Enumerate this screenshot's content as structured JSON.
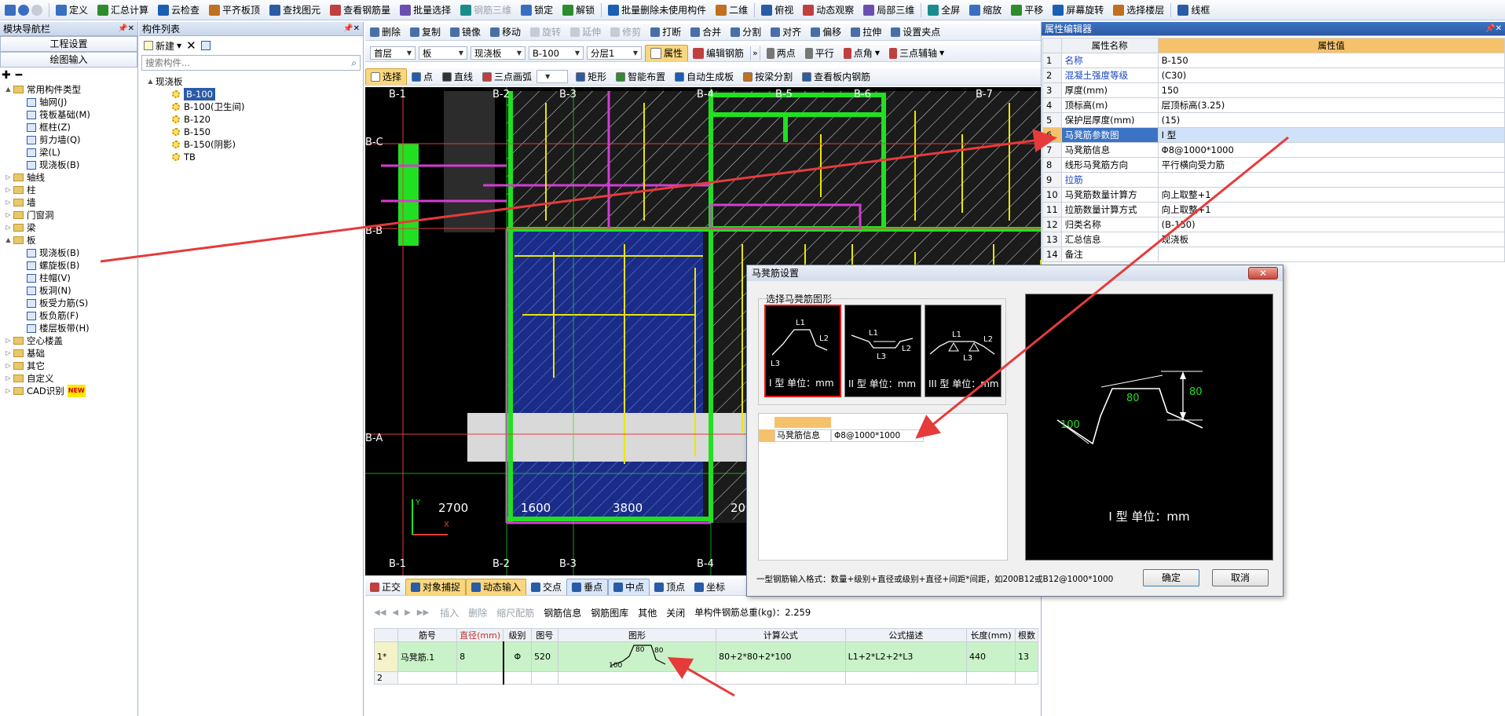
{
  "toolbar": {
    "items": [
      {
        "label": "定义",
        "icon": "define-icon"
      },
      {
        "label": "汇总计算",
        "icon": "sigma-icon"
      },
      {
        "label": "云检查",
        "icon": "cloud-check-icon"
      },
      {
        "label": "平齐板顶",
        "icon": "align-slab-icon"
      },
      {
        "label": "查找图元",
        "icon": "find-icon"
      },
      {
        "label": "查看钢筋量",
        "icon": "rebar-view-icon"
      },
      {
        "label": "批量选择",
        "icon": "batch-select-icon"
      },
      {
        "label": "钢筋三维",
        "icon": "rebar-3d-icon"
      },
      {
        "label": "锁定",
        "icon": "lock-icon"
      },
      {
        "label": "解锁",
        "icon": "unlock-icon"
      },
      {
        "label": "批量删除未使用构件",
        "icon": "batch-delete-icon"
      },
      {
        "label": "二维",
        "icon": "2d-icon"
      },
      {
        "label": "俯视",
        "icon": "top-view-icon"
      },
      {
        "label": "动态观察",
        "icon": "orbit-icon"
      },
      {
        "label": "局部三维",
        "icon": "local-3d-icon"
      },
      {
        "label": "全屏",
        "icon": "fullscreen-icon"
      },
      {
        "label": "缩放",
        "icon": "zoom-icon"
      },
      {
        "label": "平移",
        "icon": "pan-icon"
      },
      {
        "label": "屏幕旋转",
        "icon": "rotate-screen-icon"
      },
      {
        "label": "选择楼层",
        "icon": "floor-select-icon"
      },
      {
        "label": "线框",
        "icon": "wireframe-icon"
      }
    ]
  },
  "nav": {
    "title": "模块导航栏",
    "btn_project": "工程设置",
    "btn_draw": "绘图输入",
    "tree": [
      {
        "label": "常用构件类型",
        "level": 0,
        "type": "folder",
        "exp": "▲"
      },
      {
        "label": "轴网(J)",
        "level": 1,
        "type": "comp"
      },
      {
        "label": "筏板基础(M)",
        "level": 1,
        "type": "comp"
      },
      {
        "label": "框柱(Z)",
        "level": 1,
        "type": "comp"
      },
      {
        "label": "剪力墙(Q)",
        "level": 1,
        "type": "comp"
      },
      {
        "label": "梁(L)",
        "level": 1,
        "type": "comp"
      },
      {
        "label": "现浇板(B)",
        "level": 1,
        "type": "comp"
      },
      {
        "label": "轴线",
        "level": 0,
        "type": "folder",
        "exp": "▷"
      },
      {
        "label": "柱",
        "level": 0,
        "type": "folder",
        "exp": "▷"
      },
      {
        "label": "墙",
        "level": 0,
        "type": "folder",
        "exp": "▷"
      },
      {
        "label": "门窗洞",
        "level": 0,
        "type": "folder",
        "exp": "▷"
      },
      {
        "label": "梁",
        "level": 0,
        "type": "folder",
        "exp": "▷"
      },
      {
        "label": "板",
        "level": 0,
        "type": "folder",
        "exp": "▲"
      },
      {
        "label": "现浇板(B)",
        "level": 1,
        "type": "comp"
      },
      {
        "label": "螺旋板(B)",
        "level": 1,
        "type": "comp"
      },
      {
        "label": "柱帽(V)",
        "level": 1,
        "type": "comp"
      },
      {
        "label": "板洞(N)",
        "level": 1,
        "type": "comp"
      },
      {
        "label": "板受力筋(S)",
        "level": 1,
        "type": "comp"
      },
      {
        "label": "板负筋(F)",
        "level": 1,
        "type": "comp"
      },
      {
        "label": "楼层板带(H)",
        "level": 1,
        "type": "comp"
      },
      {
        "label": "空心楼盖",
        "level": 0,
        "type": "folder",
        "exp": "▷"
      },
      {
        "label": "基础",
        "level": 0,
        "type": "folder",
        "exp": "▷"
      },
      {
        "label": "其它",
        "level": 0,
        "type": "folder",
        "exp": "▷"
      },
      {
        "label": "自定义",
        "level": 0,
        "type": "folder",
        "exp": "▷"
      },
      {
        "label": "CAD识别",
        "level": 0,
        "type": "folder",
        "exp": "▷",
        "badge": "NEW"
      }
    ]
  },
  "comp_list": {
    "title": "构件列表",
    "new_label": "新建",
    "search_placeholder": "搜索构件...",
    "root": "现浇板",
    "items": [
      "B-100",
      "B-100(卫生间)",
      "B-120",
      "B-150",
      "B-150(阴影)",
      "TB"
    ],
    "selected": "B-100"
  },
  "draw_toolbar1": {
    "items": [
      "删除",
      "复制",
      "镜像",
      "移动",
      "旋转",
      "延伸",
      "修剪",
      "打断",
      "合并",
      "分割",
      "对齐",
      "偏移",
      "拉伸",
      "设置夹点"
    ]
  },
  "draw_toolbar2": {
    "floor": "首层",
    "type": "板",
    "category": "现浇板",
    "component": "B-100",
    "layer": "分层1",
    "attr": "属性",
    "edit_rebar": "编辑钢筋",
    "two_pts": "两点",
    "parallel": "平行",
    "corner": "点角",
    "three_pt_axis": "三点辅轴"
  },
  "draw_toolbar3": {
    "items": [
      "选择",
      "点",
      "直线",
      "三点画弧",
      "矩形",
      "智能布置",
      "自动生成板",
      "按梁分割",
      "查看板内钢筋"
    ]
  },
  "cad": {
    "axes_top": [
      "B-1",
      "B-2",
      "B-3",
      "B-4",
      "B-5",
      "B-6",
      "B-7"
    ],
    "axes_side": [
      "B-C",
      "B-B",
      "B-A"
    ],
    "dims": [
      "2700",
      "1600",
      "3800",
      "20"
    ]
  },
  "snapbar": {
    "items": [
      "正交",
      "对象捕捉",
      "动态输入",
      "交点",
      "垂点",
      "中点",
      "顶点",
      "坐标"
    ]
  },
  "gridbar": {
    "items": [
      "插入",
      "删除",
      "缩尺配筋",
      "钢筋信息",
      "钢筋图库",
      "其他",
      "关闭"
    ],
    "total": "单构件钢筋总重(kg)：2.259"
  },
  "grid": {
    "headers": [
      "",
      "筋号",
      "直径(mm)",
      "级别",
      "图号",
      "图形",
      "计算公式",
      "公式描述",
      "长度(mm)",
      "根数"
    ],
    "row1": {
      "idx": "1*",
      "name": "马凳筋.1",
      "dia": "8",
      "grade": "Φ",
      "fig": "520",
      "formula": "80+2*80+2*100",
      "desc": "L1+2*L2+2*L3",
      "len": "440",
      "count": "13"
    },
    "row2": {
      "idx": "2"
    },
    "shape_dims": [
      "80",
      "80",
      "100"
    ]
  },
  "props": {
    "title": "属性编辑器",
    "col_name": "属性名称",
    "col_value": "属性值",
    "rows": [
      {
        "n": "1",
        "name": "名称",
        "value": "B-150",
        "link": true
      },
      {
        "n": "2",
        "name": "混凝土强度等级",
        "value": "(C30)",
        "link": true
      },
      {
        "n": "3",
        "name": "厚度(mm)",
        "value": "150",
        "link": false
      },
      {
        "n": "4",
        "name": "顶标高(m)",
        "value": "层顶标高(3.25)",
        "link": false
      },
      {
        "n": "5",
        "name": "保护层厚度(mm)",
        "value": "(15)",
        "link": false
      },
      {
        "n": "6",
        "name": "马凳筋参数图",
        "value": "I 型",
        "link": false,
        "selected": true
      },
      {
        "n": "7",
        "name": "马凳筋信息",
        "value": "Φ8@1000*1000",
        "link": false
      },
      {
        "n": "8",
        "name": "线形马凳筋方向",
        "value": "平行横向受力筋",
        "link": false
      },
      {
        "n": "9",
        "name": "拉筋",
        "value": "",
        "link": true
      },
      {
        "n": "10",
        "name": "马凳筋数量计算方",
        "value": "向上取整+1",
        "link": false
      },
      {
        "n": "11",
        "name": "拉筋数量计算方式",
        "value": "向上取整+1",
        "link": false
      },
      {
        "n": "12",
        "name": "归类名称",
        "value": "(B-150)",
        "link": false
      },
      {
        "n": "13",
        "name": "汇总信息",
        "value": "现浇板",
        "link": false
      },
      {
        "n": "14",
        "name": "备注",
        "value": "",
        "link": false
      }
    ]
  },
  "dialog": {
    "title": "马凳筋设置",
    "close": "✕",
    "group_label": "选择马凳筋图形",
    "shapes": [
      {
        "caption": "I 型 单位：mm"
      },
      {
        "caption": "II 型 单位：mm"
      },
      {
        "caption": "III 型 单位：mm"
      }
    ],
    "shape_labels": {
      "I": [
        "L1",
        "L2",
        "L3"
      ],
      "II": [
        "L1",
        "L2",
        "L3"
      ],
      "III": [
        "L1",
        "L2",
        "L3"
      ]
    },
    "info_label": "马凳筋信息",
    "info_value": "Φ8@1000*1000",
    "preview_caption": "I 型  单位：mm",
    "preview_dims": [
      "80",
      "80",
      "100"
    ],
    "hint": "一型钢筋输入格式：数量+级别+直径或级别+直径+间距*间距，如200B12或B12@1000*1000",
    "ok": "确定",
    "cancel": "取消"
  },
  "colors": {
    "accent": "#1a5fb4",
    "highlight": "#f5c26b",
    "cad_bg": "#000000",
    "green": "#21e021",
    "magenta": "#d43cd4",
    "yellow": "#e8e800",
    "red": "#e53b3b"
  }
}
